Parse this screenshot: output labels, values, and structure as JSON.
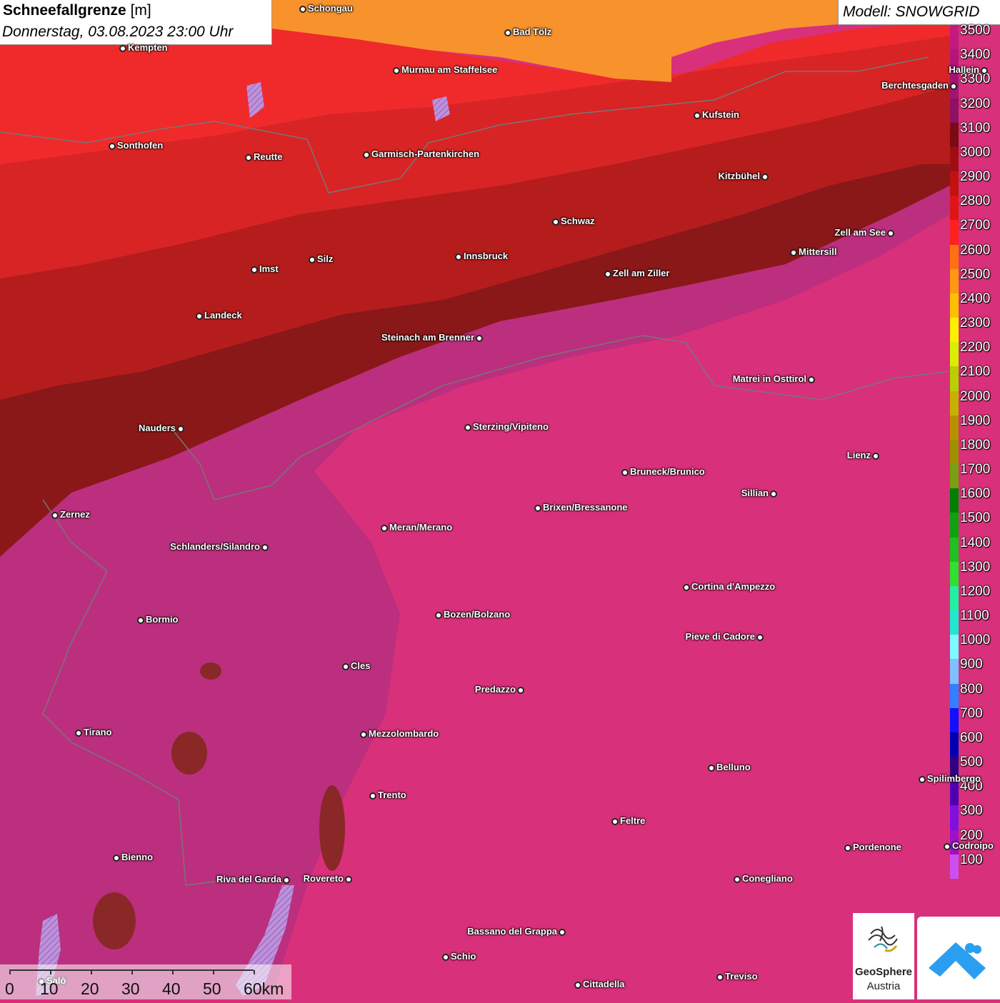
{
  "title": {
    "parameter": "Schneefallgrenze",
    "unit": "[m]",
    "datetime": "Donnerstag, 03.08.2023 23:00 Uhr"
  },
  "model": "Modell: SNOWGRID",
  "legend": {
    "labels": [
      "3500",
      "3400",
      "3300",
      "3200",
      "3100",
      "3000",
      "2900",
      "2800",
      "2700",
      "2600",
      "2500",
      "2400",
      "2300",
      "2200",
      "2100",
      "2000",
      "1900",
      "1800",
      "1700",
      "1600",
      "1500",
      "1400",
      "1300",
      "1200",
      "1100",
      "1000",
      "900",
      "800",
      "700",
      "600",
      "500",
      "400",
      "300",
      "200",
      "100"
    ],
    "colors": [
      "#c21a7e",
      "#b5157a",
      "#a11473",
      "#8e1163",
      "#7a0a14",
      "#a00e12",
      "#c11212",
      "#dd1515",
      "#ff2020",
      "#ff7010",
      "#ff9a10",
      "#ffc000",
      "#ffee00",
      "#d8f000",
      "#b8d000",
      "#c8b000",
      "#b89000",
      "#a09000",
      "#78a010",
      "#008000",
      "#10a010",
      "#20c020",
      "#30e030",
      "#20f0a0",
      "#20e8d0",
      "#80f8ff",
      "#80c0ff",
      "#3080ff",
      "#1010ff",
      "#0000b0",
      "#300080",
      "#5000b0",
      "#8010e0",
      "#a010c8",
      "#cc50f0"
    ]
  },
  "cities": [
    {
      "name": "Schongau"
    },
    {
      "name": "Bad Tölz"
    },
    {
      "name": "Kempten"
    },
    {
      "name": "Murnau am Staffelsee"
    },
    {
      "name": "Hallein"
    },
    {
      "name": "Berchtesgaden"
    },
    {
      "name": "Kufstein"
    },
    {
      "name": "Sonthofen"
    },
    {
      "name": "Reutte"
    },
    {
      "name": "Garmisch-Partenkirchen"
    },
    {
      "name": "Kitzbühel"
    },
    {
      "name": "Schwaz"
    },
    {
      "name": "Zell am See"
    },
    {
      "name": "Mittersill"
    },
    {
      "name": "Innsbruck"
    },
    {
      "name": "Silz"
    },
    {
      "name": "Imst"
    },
    {
      "name": "Zell am Ziller"
    },
    {
      "name": "Landeck"
    },
    {
      "name": "Steinach am Brenner"
    },
    {
      "name": "Matrei in Osttirol"
    },
    {
      "name": "Nauders"
    },
    {
      "name": "Sterzing/Vipiteno"
    },
    {
      "name": "Lienz"
    },
    {
      "name": "Bruneck/Brunico"
    },
    {
      "name": "Sillian"
    },
    {
      "name": "Brixen/Bressanone"
    },
    {
      "name": "Zernez"
    },
    {
      "name": "Meran/Merano"
    },
    {
      "name": "Schlanders/Silandro"
    },
    {
      "name": "Cortina d'Ampezzo"
    },
    {
      "name": "Bozen/Bolzano"
    },
    {
      "name": "Bormio"
    },
    {
      "name": "Pieve di Cadore"
    },
    {
      "name": "Cles"
    },
    {
      "name": "Predazzo"
    },
    {
      "name": "Tirano"
    },
    {
      "name": "Mezzolombardo"
    },
    {
      "name": "Belluno"
    },
    {
      "name": "Spilimbergo"
    },
    {
      "name": "Trento"
    },
    {
      "name": "Feltre"
    },
    {
      "name": "Pordenone"
    },
    {
      "name": "Codroipo"
    },
    {
      "name": "Bienno"
    },
    {
      "name": "Riva del Garda"
    },
    {
      "name": "Rovereto"
    },
    {
      "name": "Conegliano"
    },
    {
      "name": "Bassano del Grappa"
    },
    {
      "name": "Schio"
    },
    {
      "name": "Treviso"
    },
    {
      "name": "Cittadella"
    },
    {
      "name": "Salò"
    }
  ],
  "scale": {
    "labels": [
      "0",
      "10",
      "20",
      "30",
      "40",
      "50",
      "60km"
    ]
  },
  "logos": {
    "geosphere_line1": "GeoSphere",
    "geosphere_line2": "Austria"
  }
}
